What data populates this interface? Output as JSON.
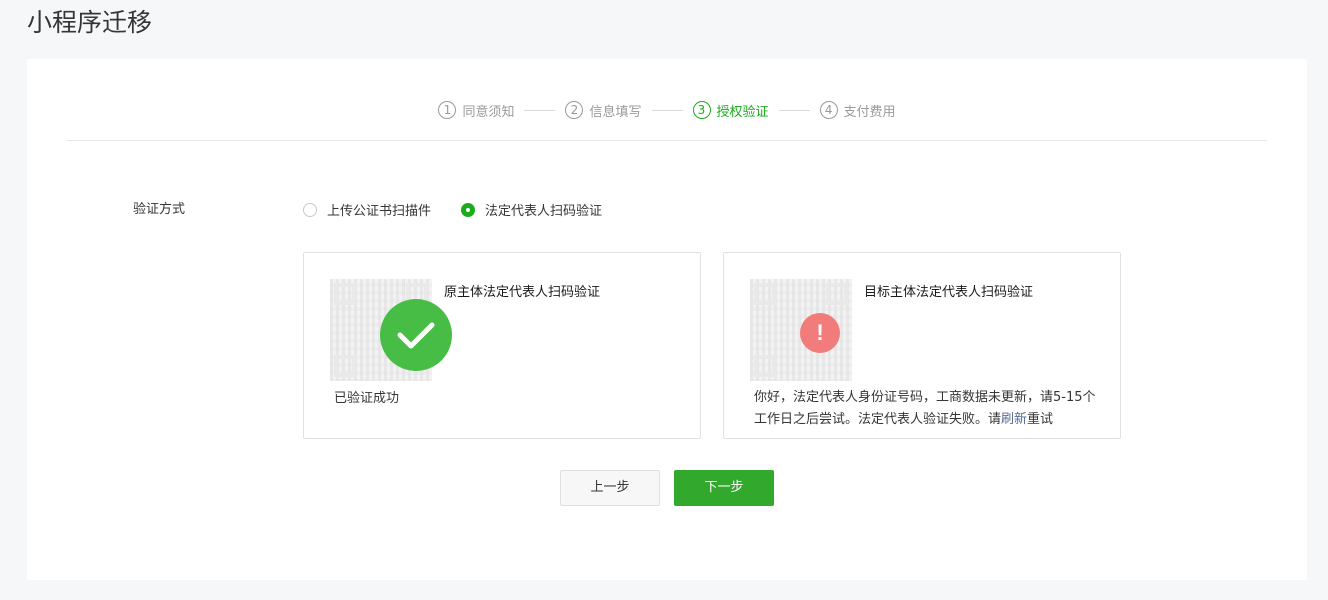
{
  "page": {
    "title": "小程序迁移"
  },
  "steps": [
    {
      "num": "1",
      "label": "同意须知",
      "active": false
    },
    {
      "num": "2",
      "label": "信息填写",
      "active": false
    },
    {
      "num": "3",
      "label": "授权验证",
      "active": true
    },
    {
      "num": "4",
      "label": "支付费用",
      "active": false
    }
  ],
  "verification": {
    "label": "验证方式",
    "options": [
      {
        "label": "上传公证书扫描件",
        "checked": false
      },
      {
        "label": "法定代表人扫码验证",
        "checked": true
      }
    ]
  },
  "boxes": {
    "original": {
      "title": "原主体法定代表人扫码验证",
      "status": "已验证成功",
      "icon": "check-icon"
    },
    "target": {
      "title": "目标主体法定代表人扫码验证",
      "message_before": "你好，法定代表人身份证号码，工商数据未更新，请5-15个工作日之后尝试。法定代表人验证失败。请",
      "refresh_link": "刷新",
      "message_after": "重试",
      "icon_glyph": "!",
      "icon": "exclamation-icon"
    }
  },
  "buttons": {
    "prev_label": "上一步",
    "next_label": "下一步"
  },
  "colors": {
    "brand_green": "#1aad19",
    "error_red": "#f05b5b",
    "link_blue": "#576b95"
  }
}
